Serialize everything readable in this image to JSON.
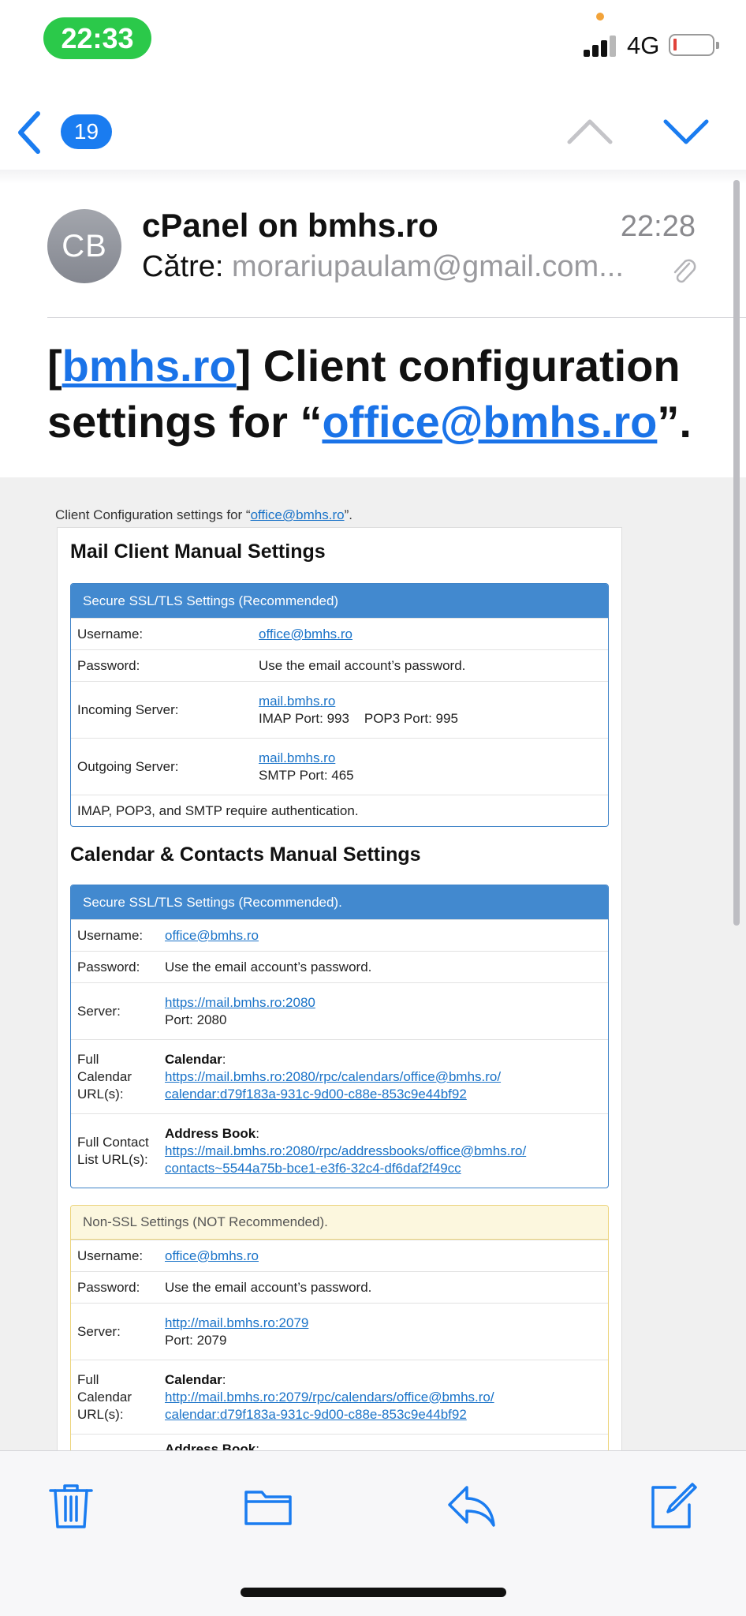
{
  "status_bar": {
    "time": "22:33",
    "network": "4G"
  },
  "nav": {
    "message_count": "19"
  },
  "message": {
    "avatar_initials": "CB",
    "sender": "cPanel on bmhs.ro",
    "time": "22:28",
    "to_label": "Către:",
    "to_address": "morariupaulam@gmail.com...",
    "subject": {
      "open_bracket": "[",
      "domain_link": "bmhs.ro",
      "part1": "] Client configuration settings for “",
      "email_link": "office@bmhs.ro",
      "end": "”."
    }
  },
  "body": {
    "intro_prefix": "Client Configuration settings for “",
    "intro_link": "office@bmhs.ro",
    "intro_suffix": "”.",
    "mail_section": {
      "title": "Mail Client Manual Settings",
      "panel_title": "Secure SSL/TLS Settings (Recommended)",
      "username_label": "Username:",
      "username_value": "office@bmhs.ro",
      "password_label": "Password:",
      "password_value": "Use the email account’s password.",
      "incoming_label": "Incoming Server:",
      "incoming_host": "mail.bmhs.ro",
      "incoming_ports": "IMAP Port: 993    POP3 Port: 995",
      "outgoing_label": "Outgoing Server:",
      "outgoing_host": "mail.bmhs.ro",
      "outgoing_port": "SMTP Port: 465",
      "auth_note": "IMAP, POP3, and SMTP require authentication."
    },
    "calendar_section": {
      "title": "Calendar & Contacts Manual Settings",
      "secure": {
        "panel_title": "Secure SSL/TLS Settings (Recommended).",
        "username_label": "Username:",
        "username_value": "office@bmhs.ro",
        "password_label": "Password:",
        "password_value": "Use the email account’s password.",
        "server_label": "Server:",
        "server_url": "https://mail.bmhs.ro:2080",
        "server_port": "Port: 2080",
        "calendar_label": "Full Calendar URL(s):",
        "calendar_heading": "Calendar",
        "calendar_url_1": "https://mail.bmhs.ro:2080/rpc/calendars/office@bmhs.ro/",
        "calendar_url_2": "calendar:d79f183a-931c-9d00-c88e-853c9e44bf92",
        "contact_label": "Full Contact List URL(s):",
        "contact_heading": "Address Book",
        "contact_url_1": "https://mail.bmhs.ro:2080/rpc/addressbooks/office@bmhs.ro/",
        "contact_url_2": "contacts~5544a75b-bce1-e3f6-32c4-df6daf2f49cc"
      },
      "non_ssl": {
        "panel_title": "Non-SSL Settings (NOT Recommended).",
        "username_label": "Username:",
        "username_value": "office@bmhs.ro",
        "password_label": "Password:",
        "password_value": "Use the email account’s password.",
        "server_label": "Server:",
        "server_url": "http://mail.bmhs.ro:2079",
        "server_port": "Port: 2079",
        "calendar_label": "Full Calendar URL(s):",
        "calendar_heading": "Calendar",
        "calendar_url_1": "http://mail.bmhs.ro:2079/rpc/calendars/office@bmhs.ro/",
        "calendar_url_2": "calendar:d79f183a-931c-9d00-c88e-853c9e44bf92",
        "contact_heading": "Address Book"
      }
    }
  },
  "toolbar": {
    "icons": [
      "trash-icon",
      "folder-icon",
      "reply-icon",
      "compose-icon"
    ]
  },
  "colors": {
    "accent": "#1a7cf0",
    "status_green": "#2bc94a",
    "panel_blue": "#4289cf",
    "panel_warn": "#fcf7de"
  }
}
